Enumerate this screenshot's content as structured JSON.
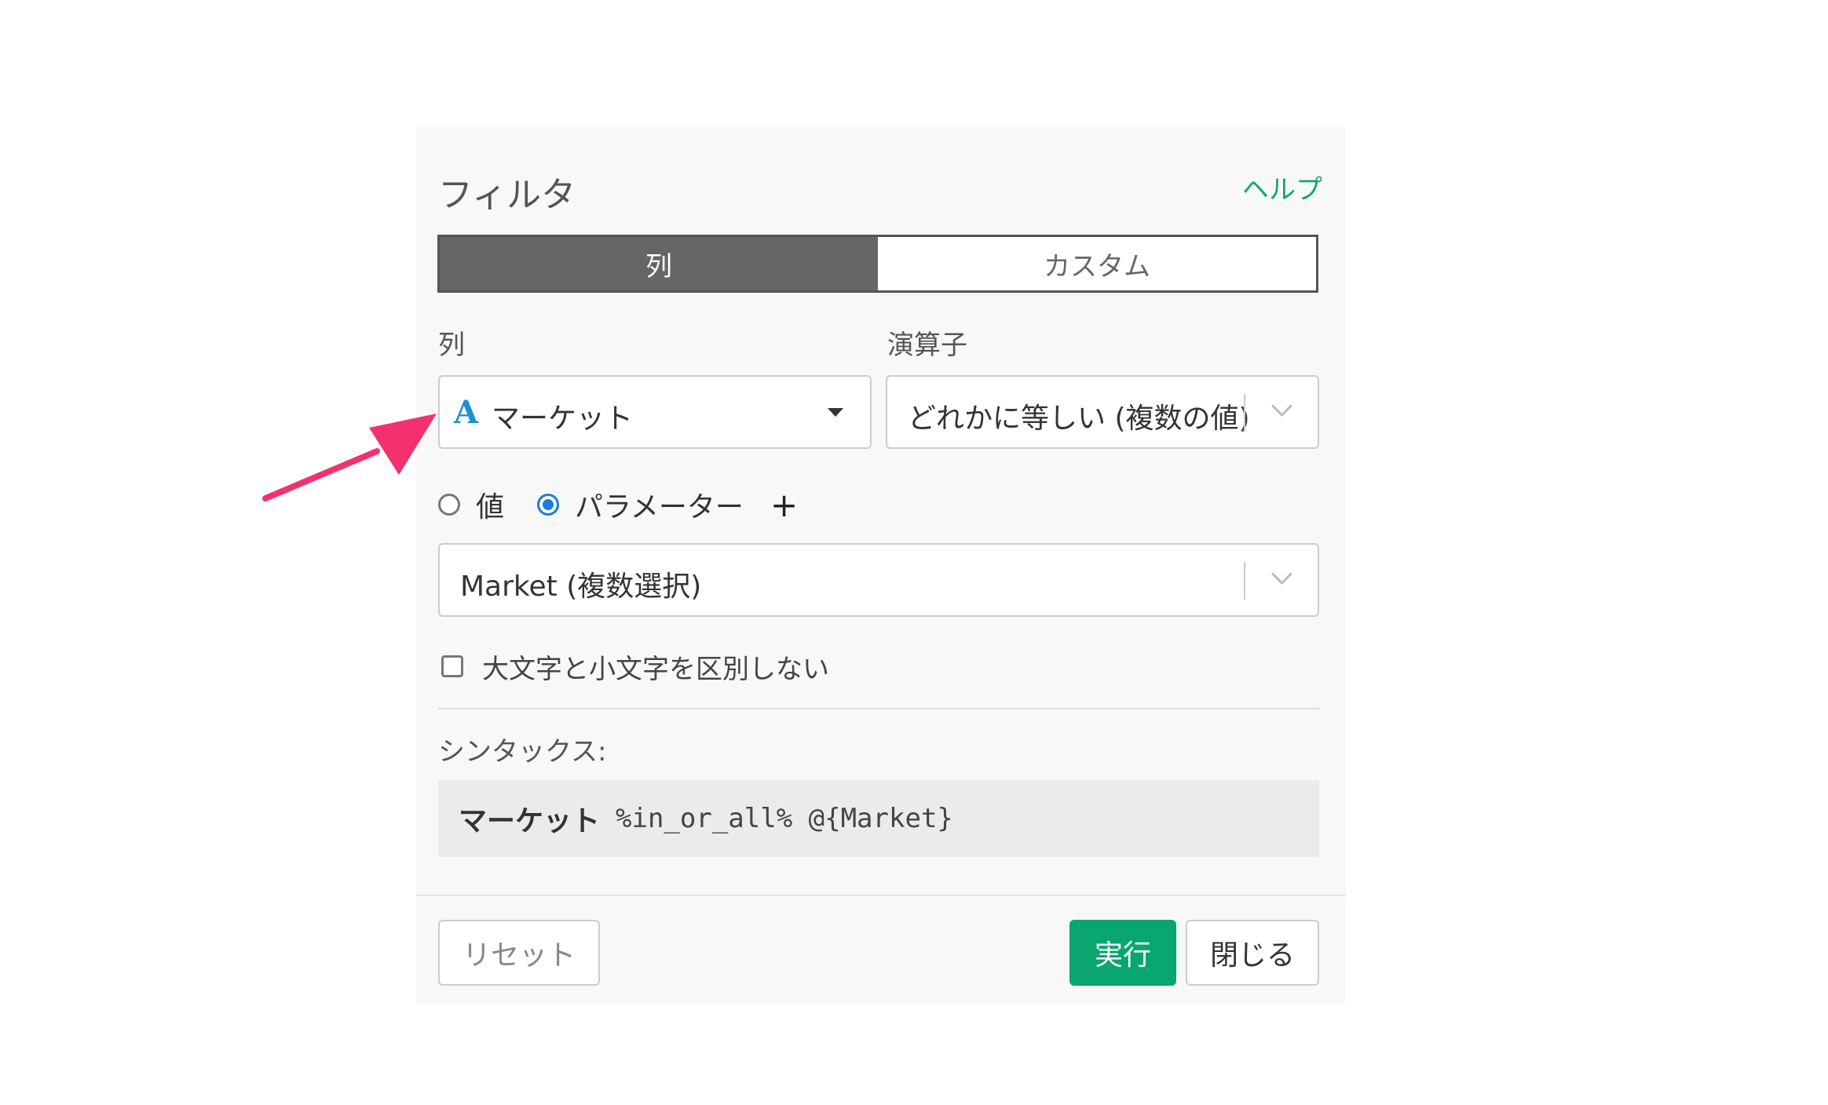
{
  "dialog": {
    "title": "フィルタ",
    "help_link": "ヘルプ",
    "tabs": [
      {
        "label": "列",
        "active": true
      },
      {
        "label": "カスタム",
        "active": false
      }
    ],
    "column_field": {
      "label": "列",
      "type_icon": "A",
      "value": "マーケット"
    },
    "operator_field": {
      "label": "演算子",
      "value": "どれかに等しい (複数の値)"
    },
    "value_mode": {
      "options": [
        {
          "label": "値",
          "checked": false
        },
        {
          "label": "パラメーター",
          "checked": true
        }
      ],
      "add_icon": "plus-icon"
    },
    "parameter_field": {
      "value": "Market (複数選択)"
    },
    "case_insensitive": {
      "label": "大文字と小文字を区別しない",
      "checked": false
    },
    "syntax": {
      "label": "シンタックス:",
      "column": "マーケット",
      "expression": "%in_or_all% @{Market}"
    },
    "buttons": {
      "reset": "リセット",
      "run": "実行",
      "close": "閉じる"
    }
  },
  "colors": {
    "accent_green": "#0aa672",
    "help_green": "#18a577",
    "active_tab": "#666666",
    "radio_blue": "#1f7ae0",
    "type_icon_blue": "#1d8fd0",
    "annotation_arrow": "#f5306e"
  },
  "annotation": {
    "icon": "arrow-icon"
  }
}
